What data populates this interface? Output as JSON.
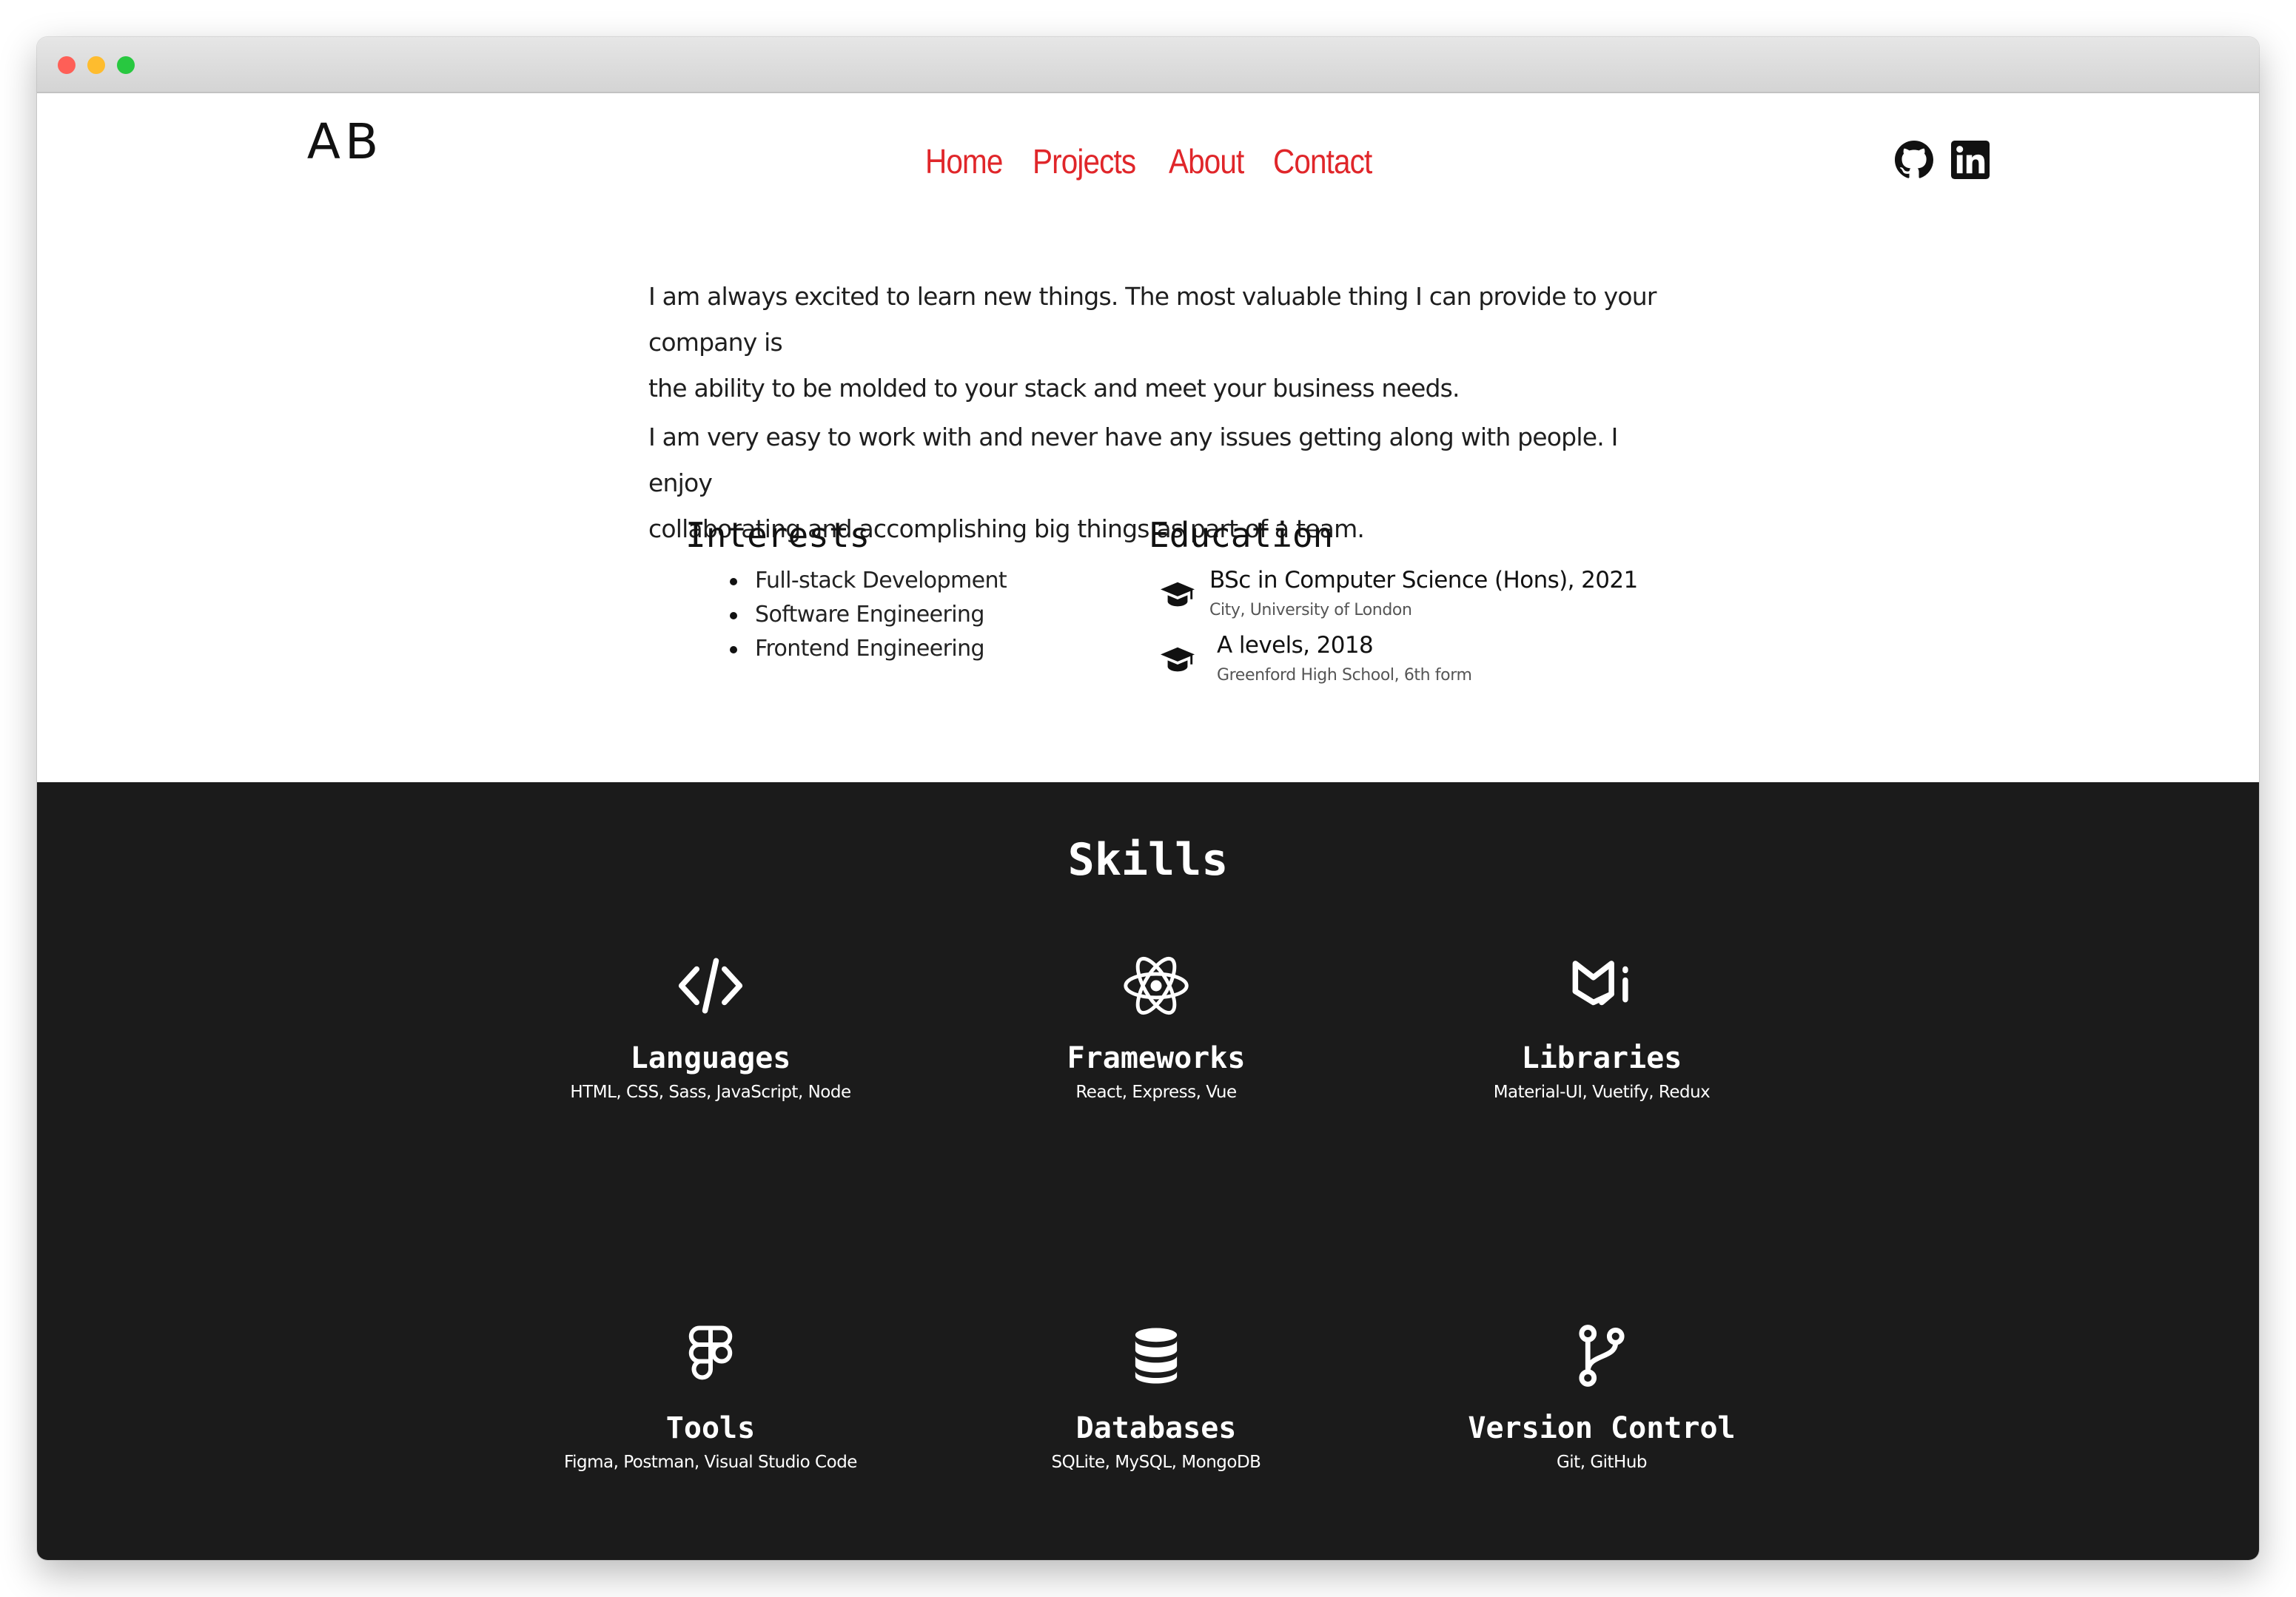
{
  "header": {
    "logo_left": "A",
    "logo_right": "B",
    "nav": {
      "home": "Home",
      "projects": "Projects",
      "about": "About",
      "contact": "Contact"
    },
    "accent_color": "#e0262a",
    "social_icons": [
      "github-icon",
      "linkedin-icon"
    ]
  },
  "about": {
    "paragraph_1_line_1": "I am always excited to learn new things. The most valuable thing I can provide to your company is",
    "paragraph_1_line_2": "the ability to be molded to your stack and meet your business needs.",
    "paragraph_2_line_1": "I am very easy to work with and never have any issues getting along with people. I enjoy",
    "paragraph_2_line_2": "collaborating and accomplishing big things as part of a team."
  },
  "interests": {
    "title": "Interests",
    "items": [
      "Full-stack Development",
      "Software Engineering",
      "Frontend Engineering"
    ]
  },
  "education": {
    "title": "Education",
    "entries": [
      {
        "degree": "BSc in Computer Science (Hons), 2021",
        "institution": "City, University of London",
        "icon": "graduation-cap-icon"
      },
      {
        "degree": "A levels, 2018",
        "institution": "Greenford High School, 6th form",
        "icon": "graduation-cap-icon"
      }
    ]
  },
  "skills": {
    "title": "Skills",
    "background_color": "#1b1b1b",
    "items": [
      {
        "title": "Languages",
        "list": "HTML, CSS, Sass, JavaScript, Node",
        "icon": "code-icon"
      },
      {
        "title": "Frameworks",
        "list": "React, Express, Vue",
        "icon": "react-icon"
      },
      {
        "title": "Libraries",
        "list": "Material-UI, Vuetify, Redux",
        "icon": "material-ui-icon"
      },
      {
        "title": "Tools",
        "list": "Figma, Postman, Visual Studio Code",
        "icon": "figma-icon"
      },
      {
        "title": "Databases",
        "list": "SQLite, MySQL, MongoDB",
        "icon": "database-icon"
      },
      {
        "title": "Version Control",
        "list": "Git, GitHub",
        "icon": "git-branch-icon"
      }
    ]
  }
}
